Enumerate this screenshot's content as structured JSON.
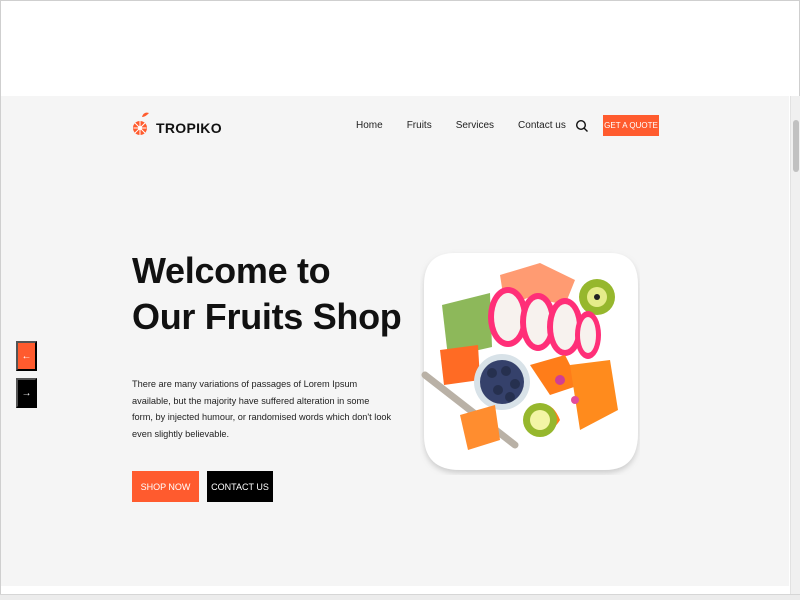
{
  "brand": {
    "name": "TROPIKO",
    "icon": "orange-fruit-icon"
  },
  "nav": {
    "items": [
      "Home",
      "Fruits",
      "Services",
      "Contact us"
    ],
    "search_icon": "search-icon",
    "quote_label": "GET A QUOTE"
  },
  "hero": {
    "title_line1": "Welcome to",
    "title_line2": "Our Fruits Shop",
    "description": "There are many variations of passages of Lorem Ipsum available, but the majority have suffered alteration in some form, by injected humour, or randomised words which don't look even slightly believable.",
    "primary_button": "SHOP NOW",
    "secondary_button": "CONTACT US"
  },
  "carousel": {
    "prev_icon": "arrow-left-icon",
    "next_icon": "arrow-right-icon"
  },
  "colors": {
    "accent": "#ff5b2e",
    "dark": "#000000",
    "hero_background": "#f5f5f5"
  }
}
